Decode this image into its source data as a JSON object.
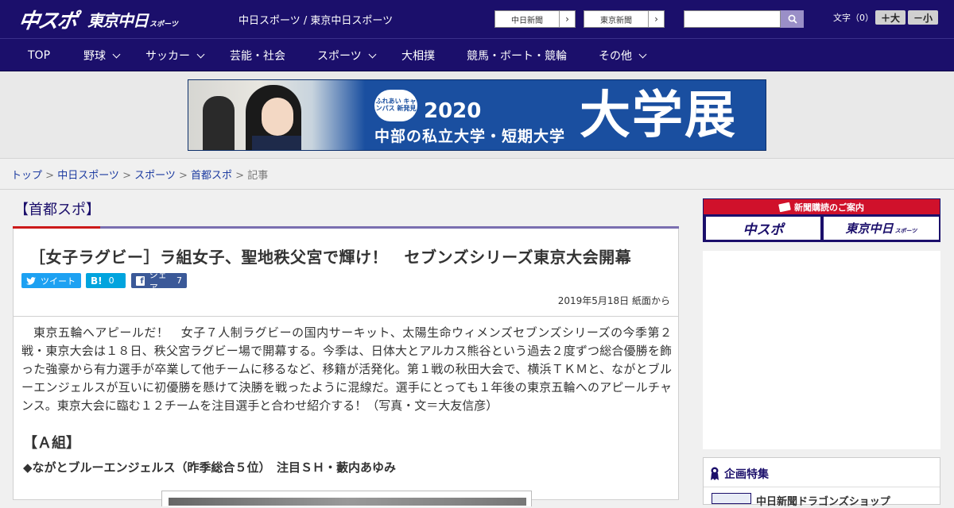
{
  "header": {
    "logo_main": "中スポ",
    "logo_tokyo": "東京中日",
    "logo_tokyo_small": "スポーツ",
    "site_title": "中日スポーツ / 東京中日スポーツ",
    "link_chunichi": "中日新聞",
    "link_tokyo": "東京新聞",
    "search_placeholder": "",
    "font_size_label": "文字（0）",
    "font_plus": "＋大",
    "font_minus": "－小"
  },
  "nav": {
    "items": [
      {
        "label": "TOP"
      },
      {
        "label": "野球"
      },
      {
        "label": "サッカー"
      },
      {
        "label": "芸能・社会"
      },
      {
        "label": "スポーツ"
      },
      {
        "label": "大相撲"
      },
      {
        "label": "競馬・ボート・競輪"
      },
      {
        "label": "その他"
      }
    ]
  },
  "banner": {
    "seal": "ふれあい キャンパス 新発見",
    "year": "2020",
    "subtitle": "中部の私立大学・短期大学",
    "big": "大学展"
  },
  "breadcrumb": {
    "items": [
      "トップ",
      "中日スポーツ",
      "スポーツ",
      "首都スポ"
    ],
    "current": "記事",
    "sep": " > "
  },
  "article": {
    "category": "【首都スポ】",
    "headline": "［女子ラグビー］ラ組女子、聖地秩父宮で輝け！　セブンズシリーズ東京大会開幕",
    "share_tweet": "ツイート",
    "share_hatena": "B!",
    "share_hatena_count": "0",
    "share_fb": "シェア",
    "share_fb_count": "7",
    "date": "2019年5月18日 紙面から",
    "body": "東京五輪へアピールだ！　女子７人制ラグビーの国内サーキット、太陽生命ウィメンズセブンズシリーズの今季第２戦・東京大会は１８日、秩父宮ラグビー場で開幕する。今季は、日体大とアルカス熊谷という過去２度ずつ総合優勝を飾った強豪から有力選手が卒業して他チームに移るなど、移籍が活発化。第１戦の秋田大会で、横浜ＴＫＭと、ながとブルーエンジェルスが互いに初優勝を懸けて決勝を戦ったように混線だ。選手にとっても１年後の東京五輪へのアピールチャンス。東京大会に臨む１２チームを注目選手と合わせ紹介する！（写真・文＝大友信彦）",
    "subhead": "【Ａ組】",
    "team": "◆ながとブルーエンジェルス（昨季総合５位）　注目ＳＨ・藪内あゆみ"
  },
  "sidebar": {
    "subscribe_label": "新聞購読のご案内",
    "sub_chuspo": "中スポ",
    "sub_tokyo": "東京中日",
    "sub_tokyo_small": "スポーツ",
    "feature_title": "企画特集",
    "feature_item": "中日新聞ドラゴンズショップ"
  },
  "colors": {
    "brand_navy": "#1b0f6b",
    "accent_red": "#d0112b",
    "twitter": "#1da1f2",
    "hatena": "#00a4de",
    "facebook": "#3b5998"
  }
}
